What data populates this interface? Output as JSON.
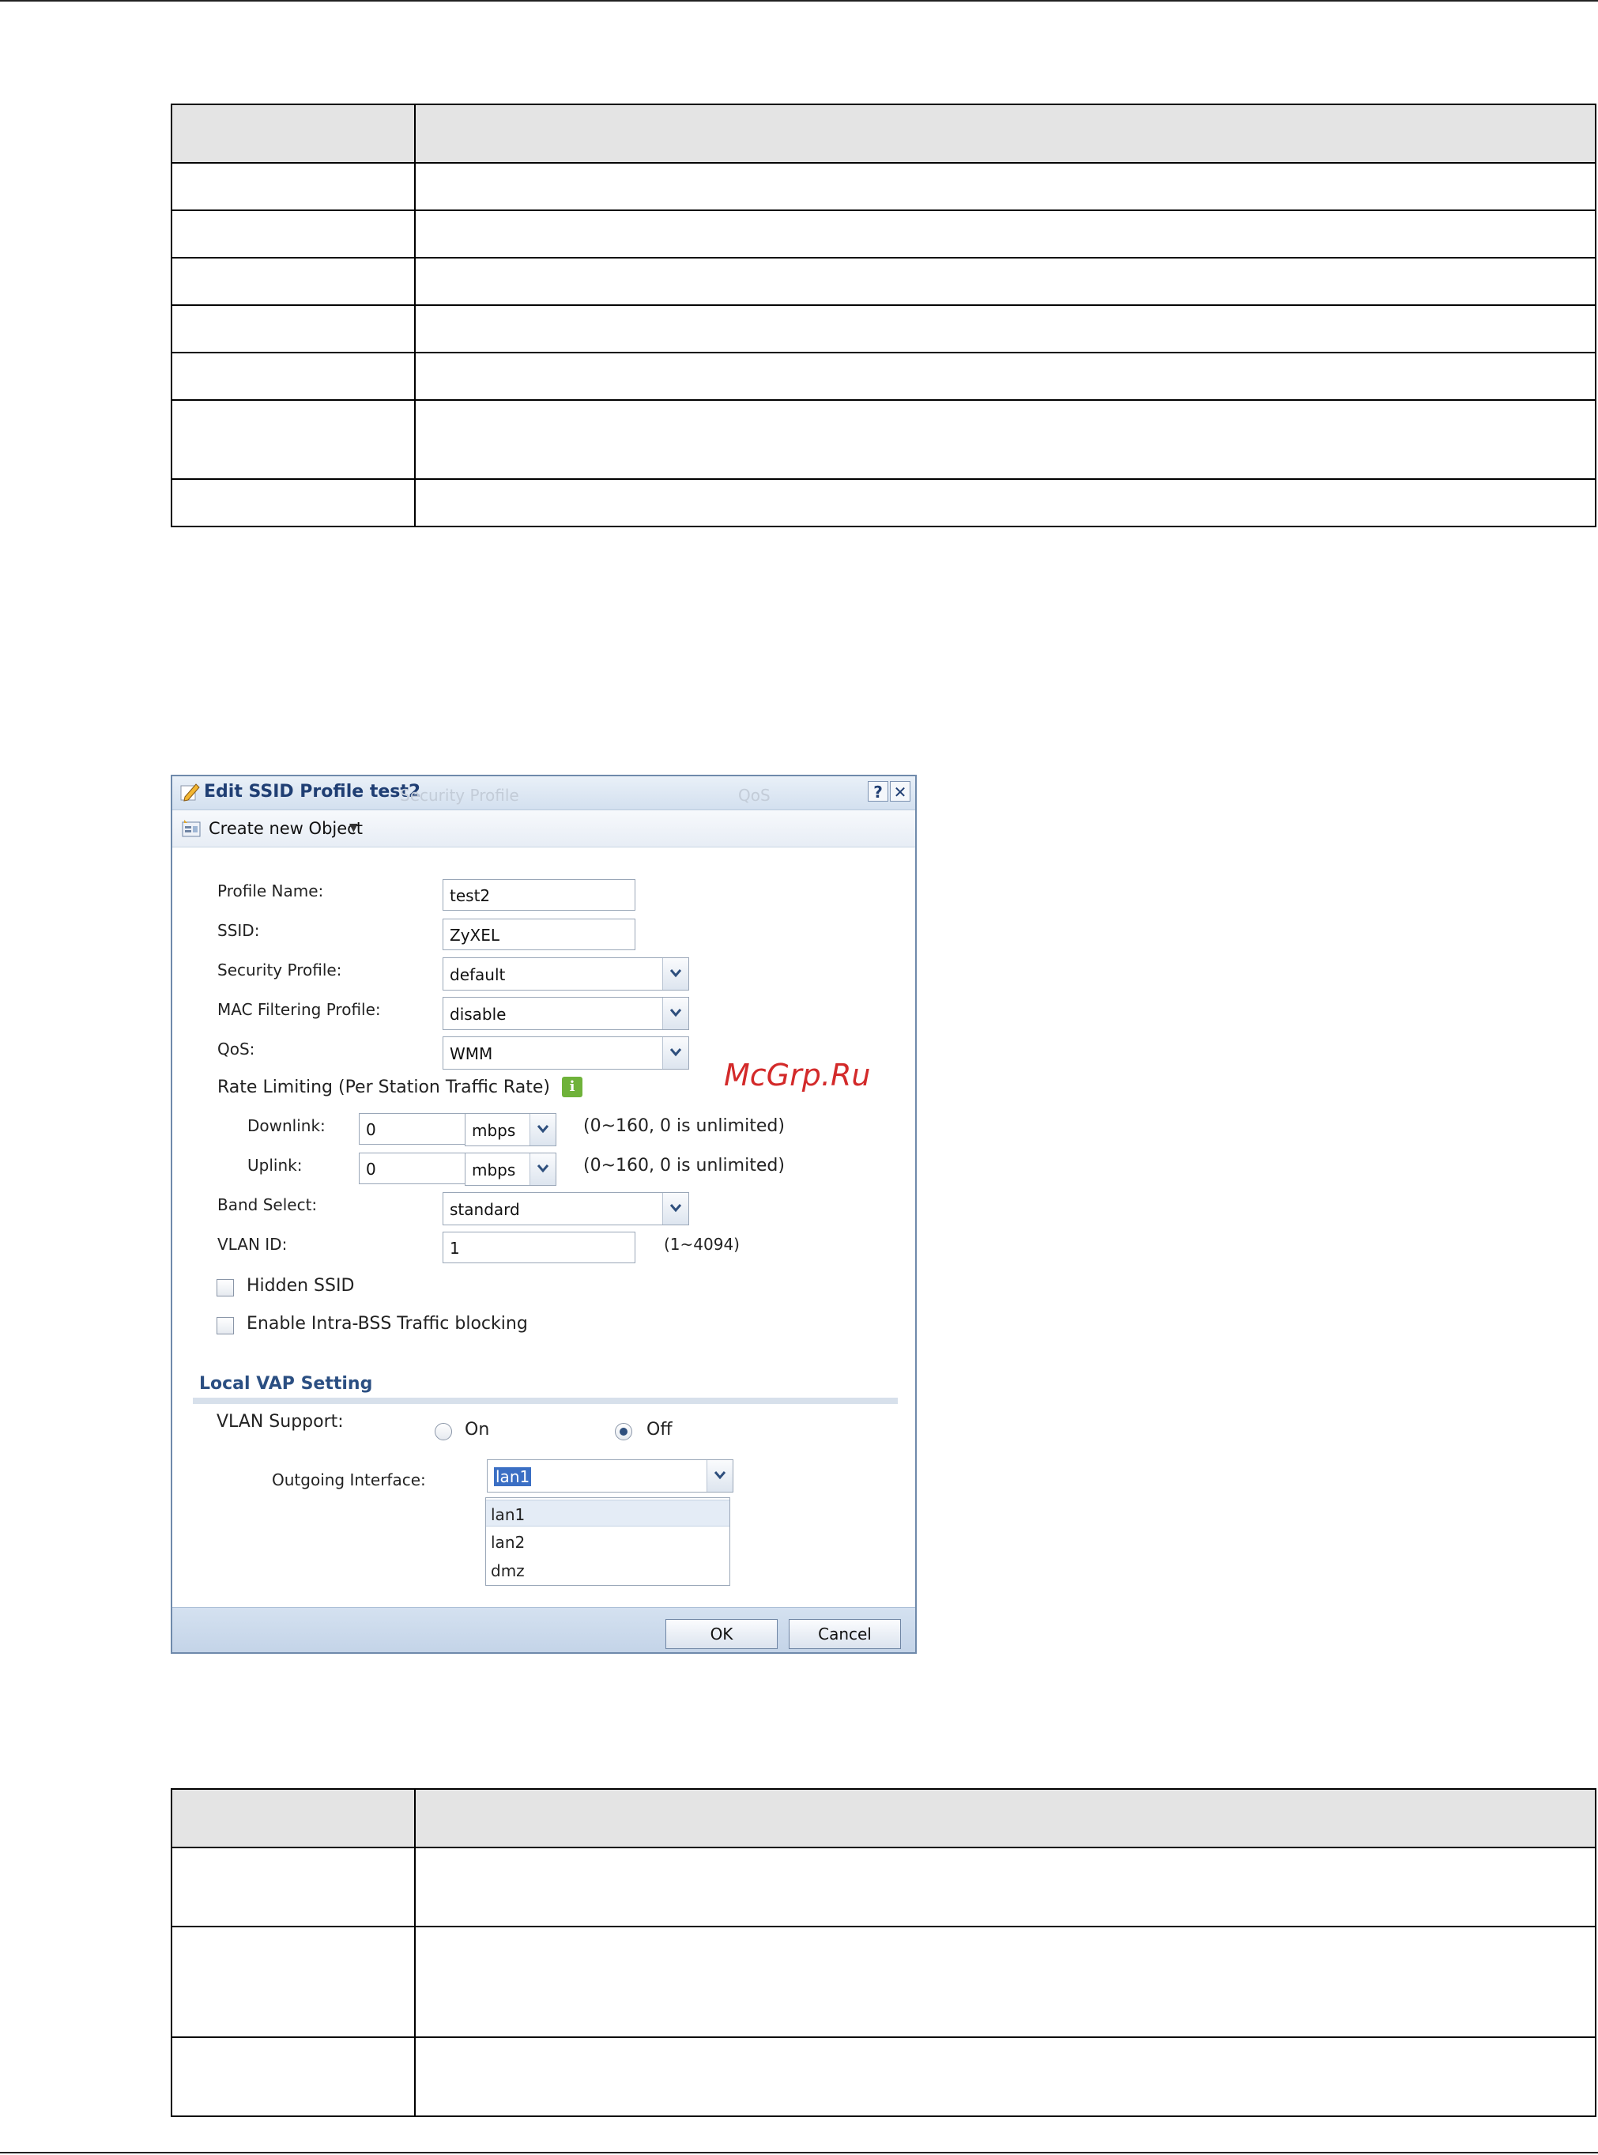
{
  "dialog": {
    "title": "Edit SSID Profile test2",
    "ghost_tabs": [
      "Security Profile",
      "QoS"
    ],
    "help_button": "?",
    "close_button": "✕",
    "toolbar": {
      "create_object_label": "Create new Object"
    },
    "fields": {
      "profile_name": {
        "label": "Profile Name:",
        "value": "test2"
      },
      "ssid": {
        "label": "SSID:",
        "value": "ZyXEL"
      },
      "security_profile": {
        "label": "Security Profile:",
        "value": "default"
      },
      "mac_filtering_profile": {
        "label": "MAC Filtering Profile:",
        "value": "disable"
      },
      "qos": {
        "label": "QoS:",
        "value": "WMM"
      },
      "rate_limiting": {
        "label": "Rate Limiting (Per Station Traffic Rate)",
        "info_icon": "i"
      },
      "downlink": {
        "label": "Downlink:",
        "value": "0",
        "unit": "mbps",
        "hint": "(0~160, 0 is unlimited)"
      },
      "uplink": {
        "label": "Uplink:",
        "value": "0",
        "unit": "mbps",
        "hint": "(0~160, 0 is unlimited)"
      },
      "band_select": {
        "label": "Band Select:",
        "value": "standard"
      },
      "vlan_id": {
        "label": "VLAN ID:",
        "value": "1",
        "hint": "(1~4094)"
      },
      "hidden_ssid": {
        "label": "Hidden SSID",
        "checked": false
      },
      "intra_bss": {
        "label": "Enable Intra-BSS Traffic blocking",
        "checked": false
      }
    },
    "local_vap": {
      "section_title": "Local VAP Setting",
      "vlan_support_label": "VLAN Support:",
      "on_label": "On",
      "off_label": "Off",
      "selected": "Off",
      "outgoing_interface_label": "Outgoing Interface:",
      "outgoing_interface_value": "lan1",
      "options": [
        "lan1",
        "lan2",
        "dmz"
      ]
    },
    "buttons": {
      "ok": "OK",
      "cancel": "Cancel"
    }
  },
  "watermark": "McGrp.Ru"
}
